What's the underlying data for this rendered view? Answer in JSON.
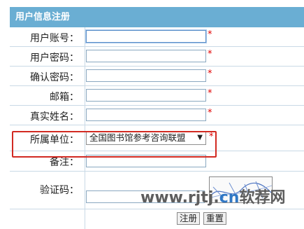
{
  "form": {
    "title": "用户信息注册",
    "required_mark": "*",
    "fields": [
      {
        "label": "用户账号：",
        "value": ""
      },
      {
        "label": "用户密码：",
        "value": ""
      },
      {
        "label": "确认密码：",
        "value": ""
      },
      {
        "label": "邮箱：",
        "value": ""
      },
      {
        "label": "真实姓名：",
        "value": ""
      },
      {
        "label": "所属单位：",
        "value": "全国图书馆参考咨询联盟"
      },
      {
        "label": "备注：",
        "value": ""
      },
      {
        "label": "验证码：",
        "value": ""
      }
    ],
    "register_button": "注册",
    "reset_button": "重置"
  },
  "watermark": {
    "prefix": "www.rjtj.",
    "cn": "cn",
    "suffix": "软荐网"
  },
  "colors": {
    "header_bg": "#6aaed3",
    "required": "#e00000",
    "highlight_box": "#d22a22",
    "watermark_cn": "#2f77c5"
  }
}
